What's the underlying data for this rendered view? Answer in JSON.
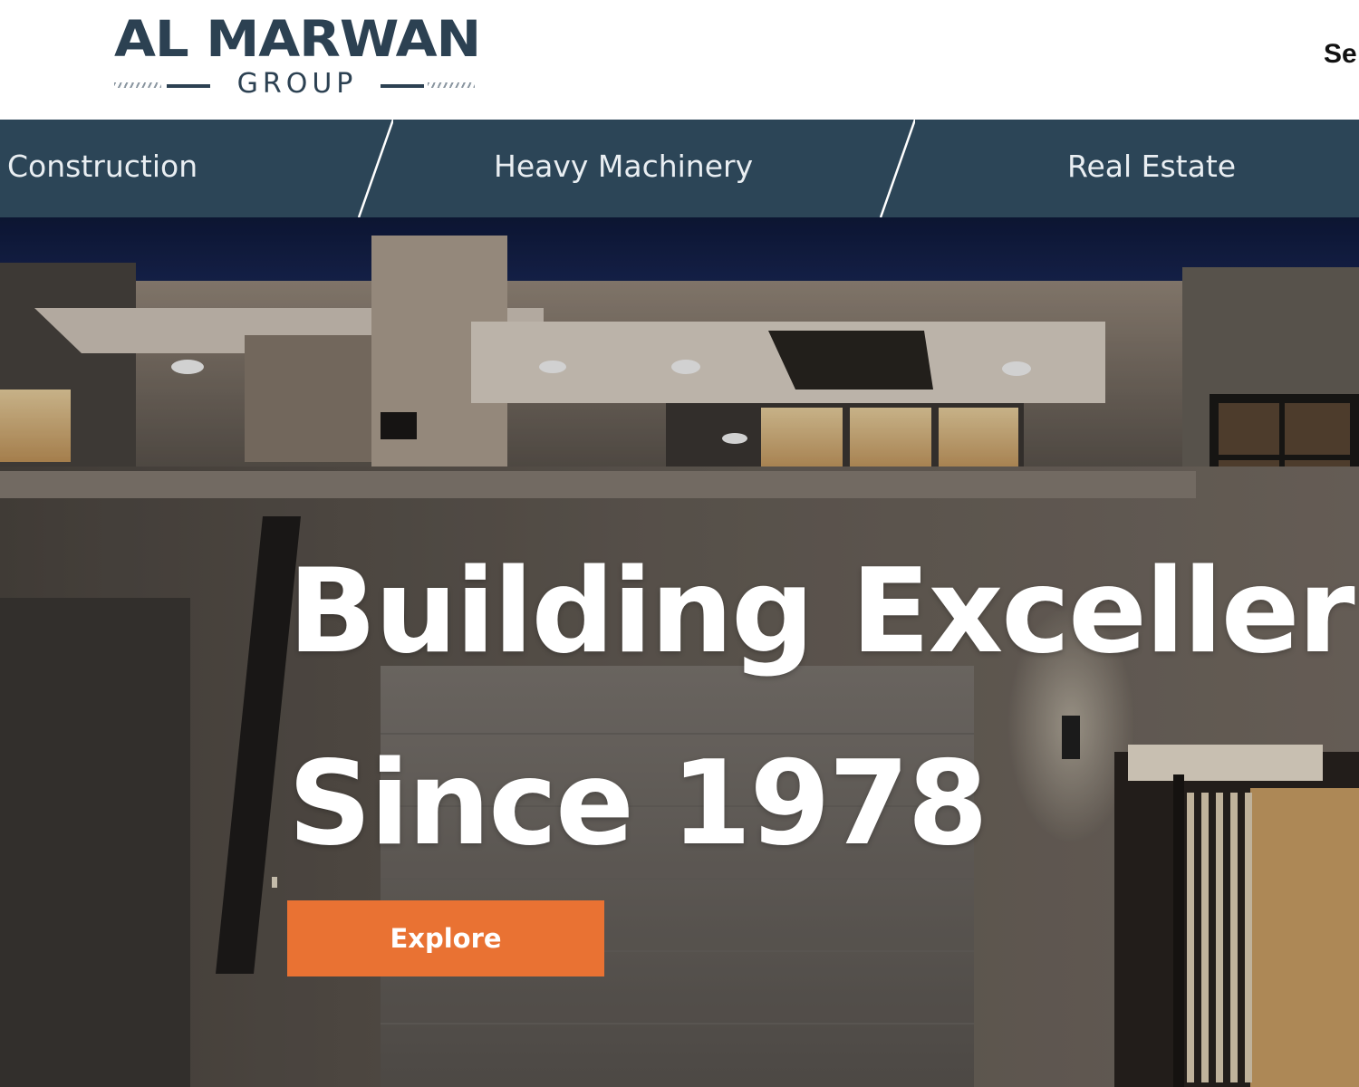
{
  "header": {
    "logo": {
      "main": "AL MARWAN",
      "sub": "GROUP"
    },
    "search_label": "Se"
  },
  "nav": {
    "items": [
      {
        "label": "Construction"
      },
      {
        "label": "Heavy Machinery"
      },
      {
        "label": "Real Estate"
      }
    ]
  },
  "hero": {
    "title_line_1": "Building Exceller",
    "title_line_2": "Since 1978",
    "cta_label": "Explore"
  },
  "colors": {
    "brand_navy": "#2c4152",
    "nav_bar": "#2c4557",
    "cta_orange": "#e97233"
  }
}
